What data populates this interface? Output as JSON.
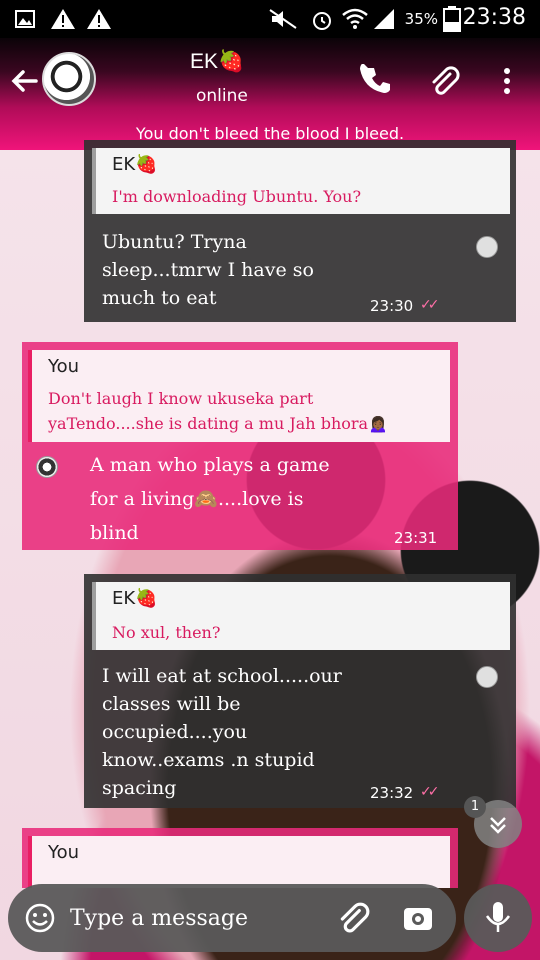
{
  "status_bar": {
    "battery_percent": "35%",
    "time": "23:38",
    "icons": [
      "image-icon",
      "warning-icon",
      "warning-icon",
      "mute-icon",
      "alarm-icon",
      "wifi-icon",
      "signal-icon",
      "battery-icon"
    ]
  },
  "header": {
    "contact_name": "EK🍓",
    "contact_status": "online",
    "quote": "You don't bleed the blood I bleed."
  },
  "messages": [
    {
      "direction": "in",
      "quoted_author": "EK🍓",
      "quoted_text": "I'm downloading Ubuntu. You?",
      "text": "Ubuntu? Tryna\nsleep...tmrw I have so\nmuch to eat",
      "time": "23:30"
    },
    {
      "direction": "out",
      "quoted_author": "You",
      "quoted_text": "Don't laugh I know ukuseka part\nyaTendo....she is dating a mu Jah bhora🙍🏾‍♀️",
      "text": "A man who plays a game\nfor a living🙈....love is\nblind",
      "time": "23:31"
    },
    {
      "direction": "in",
      "quoted_author": "EK🍓",
      "quoted_text": "No xul, then?",
      "text": "I will eat at school.....our\nclasses will be\noccupied....you\nknow..exams .n stupid\nspacing",
      "time": "23:32"
    },
    {
      "direction": "out",
      "quoted_author": "You",
      "quoted_text": "",
      "text": "",
      "time": ""
    }
  ],
  "scroll_badge": "1",
  "composer": {
    "placeholder": "Type a message"
  },
  "colors": {
    "accent": "#e91e63",
    "incoming_bubble": "#303030",
    "outgoing_bubble": "#e82a7a",
    "header_top": "#0b0308",
    "header_bottom": "#f0147a"
  }
}
